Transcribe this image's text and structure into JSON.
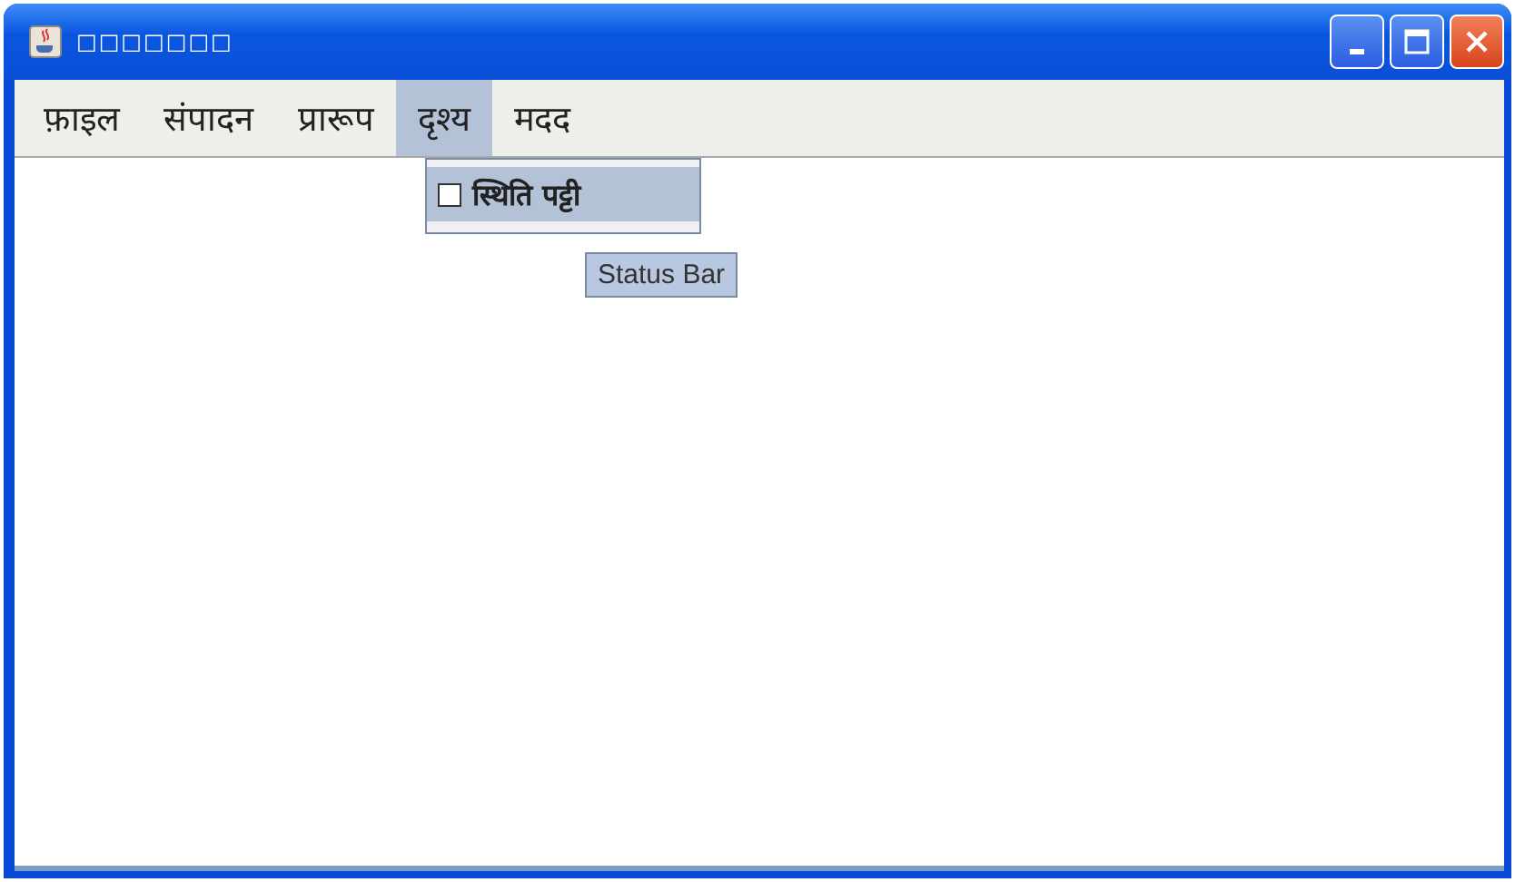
{
  "window": {
    "title": "□□□□□□□"
  },
  "menu": [
    {
      "label": "फ़ाइल",
      "selected": false
    },
    {
      "label": "संपादन",
      "selected": false
    },
    {
      "label": "प्रारूप",
      "selected": false
    },
    {
      "label": "दृश्य",
      "selected": true
    },
    {
      "label": "मदद",
      "selected": false
    }
  ],
  "dropdown": {
    "items": [
      {
        "label": "स्थिति पट्टी",
        "checked": false
      }
    ]
  },
  "tooltip": "Status Bar"
}
